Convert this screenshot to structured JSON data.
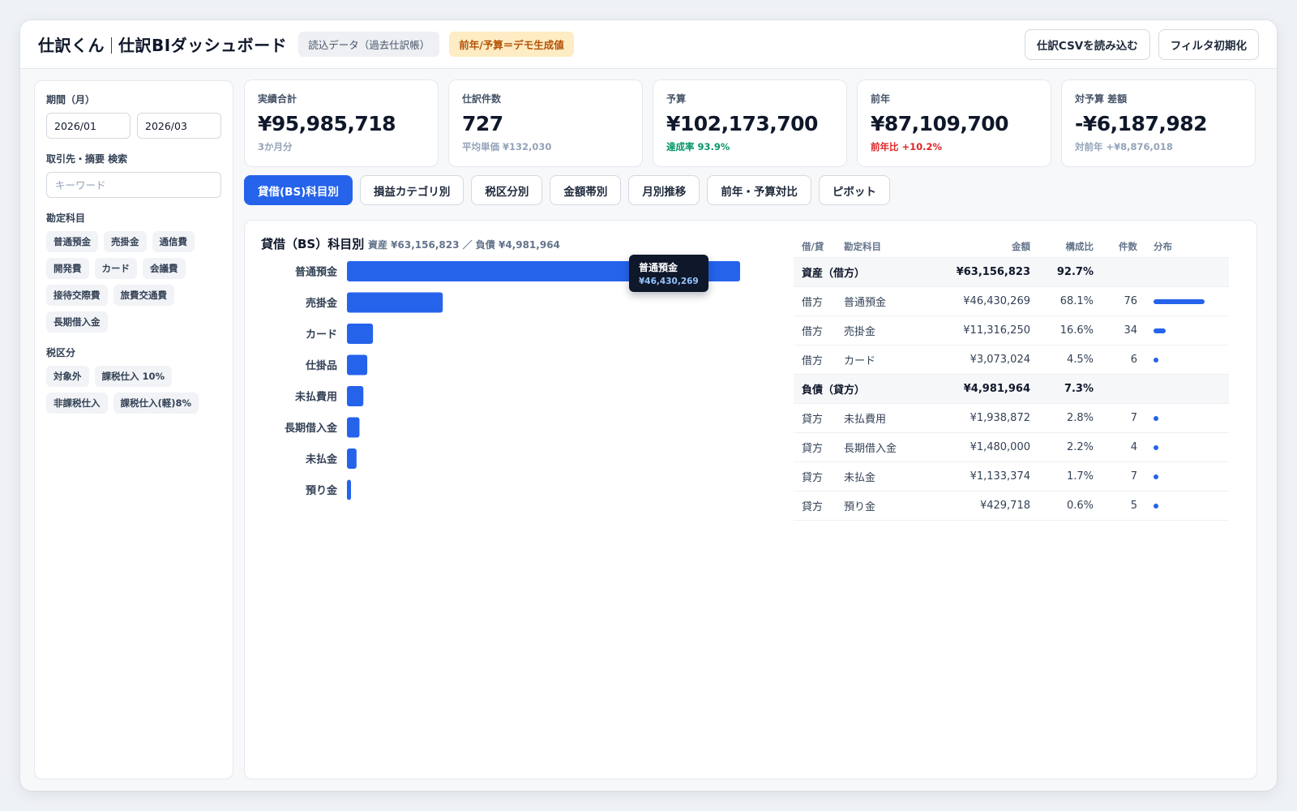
{
  "header": {
    "title_app": "仕訳くん",
    "title_page": "仕訳BIダッシュボード",
    "chip_data": "読込データ（過去仕訳帳）",
    "chip_demo": "前年/予算＝デモ生成値",
    "btn_import": "仕訳CSVを読み込む",
    "btn_reset": "フィルタ初期化"
  },
  "sidebar": {
    "period_label": "期間（月）",
    "period_from": "2026/01",
    "period_to": "2026/03",
    "search_label": "取引先・摘要 検索",
    "search_placeholder": "キーワード",
    "account_label": "勘定科目",
    "accounts": [
      "普通預金",
      "売掛金",
      "通信費",
      "開発費",
      "カード",
      "会議費",
      "接待交際費",
      "旅費交通費",
      "長期借入金"
    ],
    "tax_label": "税区分",
    "tax_items": [
      "対象外",
      "課税仕入 10%",
      "非課税仕入",
      "課税仕入(軽)8%"
    ]
  },
  "kpis": [
    {
      "label": "実績合計",
      "value": "¥95,985,718",
      "sub": "3か月分"
    },
    {
      "label": "仕訳件数",
      "value": "727",
      "sub": "平均単価 ¥132,030"
    },
    {
      "label": "予算",
      "value": "¥102,173,700",
      "sub": "達成率 93.9%"
    },
    {
      "label": "前年",
      "value": "¥87,109,700",
      "sub": "前年比 +10.2%"
    },
    {
      "label": "対予算 差額",
      "value": "-¥6,187,982",
      "sub": "対前年 +¥8,876,018"
    }
  ],
  "tabs": [
    "貸借(BS)科目別",
    "損益カテゴリ別",
    "税区分別",
    "金額帯別",
    "月別推移",
    "前年・予算対比",
    "ピボット"
  ],
  "panel": {
    "title": "貸借（BS）科目別",
    "subtitle": "資産 ¥63,156,823 ／ 負債 ¥4,981,964",
    "tooltip_title": "普通預金",
    "tooltip_value": "¥46,430,269"
  },
  "table": {
    "headers": {
      "side": "借/貸",
      "account": "勘定科目",
      "amount": "金額",
      "ratio": "構成比",
      "count": "件数",
      "dist": "分布"
    },
    "groups": [
      {
        "name": "資産（借方）",
        "amount": "¥63,156,823",
        "ratio": "92.7%",
        "rows": [
          {
            "side": "借方",
            "account": "普通預金",
            "amount": "¥46,430,269",
            "ratio": "68.1%",
            "count": "76",
            "share": 0.681
          },
          {
            "side": "借方",
            "account": "売掛金",
            "amount": "¥11,316,250",
            "ratio": "16.6%",
            "count": "34",
            "share": 0.166
          },
          {
            "side": "借方",
            "account": "カード",
            "amount": "¥3,073,024",
            "ratio": "4.5%",
            "count": "6",
            "share": 0.045
          }
        ]
      },
      {
        "name": "負債（貸方）",
        "amount": "¥4,981,964",
        "ratio": "7.3%",
        "rows": [
          {
            "side": "貸方",
            "account": "未払費用",
            "amount": "¥1,938,872",
            "ratio": "2.8%",
            "count": "7",
            "share": 0.028
          },
          {
            "side": "貸方",
            "account": "長期借入金",
            "amount": "¥1,480,000",
            "ratio": "2.2%",
            "count": "4",
            "share": 0.022
          },
          {
            "side": "貸方",
            "account": "未払金",
            "amount": "¥1,133,374",
            "ratio": "1.7%",
            "count": "7",
            "share": 0.017
          },
          {
            "side": "貸方",
            "account": "預り金",
            "amount": "¥429,718",
            "ratio": "0.6%",
            "count": "5",
            "share": 0.006
          }
        ]
      }
    ]
  },
  "colors": {
    "accent": "#2563eb",
    "green": "#059669",
    "red": "#dc2626",
    "amber_bg": "#fdecc4"
  },
  "chart_data": {
    "type": "bar",
    "orientation": "horizontal",
    "categories": [
      "普通預金",
      "売掛金",
      "カード",
      "仕掛品",
      "未払費用",
      "長期借入金",
      "未払金",
      "預り金"
    ],
    "values": [
      46430269,
      11316250,
      3073024,
      2400000,
      1938872,
      1480000,
      1133374,
      429718
    ],
    "title": "貸借（BS）科目別",
    "xlabel": "",
    "ylabel": "",
    "grid": false
  }
}
